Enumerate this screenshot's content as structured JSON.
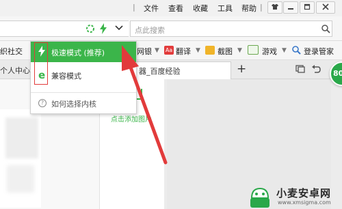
{
  "menubar": {
    "items": [
      "文件",
      "查看",
      "收藏",
      "工具",
      "帮助"
    ]
  },
  "search": {
    "placeholder": "点此搜索"
  },
  "bookmarks": {
    "left_partial": "织社交",
    "items": [
      "网银",
      "翻译",
      "截图",
      "游戏",
      "登录管家"
    ]
  },
  "tabs": {
    "left_partial": "个人中心",
    "active_partial": "器_百度经验",
    "new_tab": "+"
  },
  "page": {
    "add_image_text": "点击添加图片"
  },
  "dropdown": {
    "fast_mode": "极速模式 (推荐)",
    "compat_mode": "兼容模式",
    "how_to_choose": "如何选择内核"
  },
  "badge": {
    "number": "80"
  },
  "watermark": {
    "brand": "小麦安卓网",
    "url": "www.xmsigma.com"
  },
  "colors": {
    "accent_green": "#3bb54a",
    "highlight_red": "#e23b3b"
  }
}
